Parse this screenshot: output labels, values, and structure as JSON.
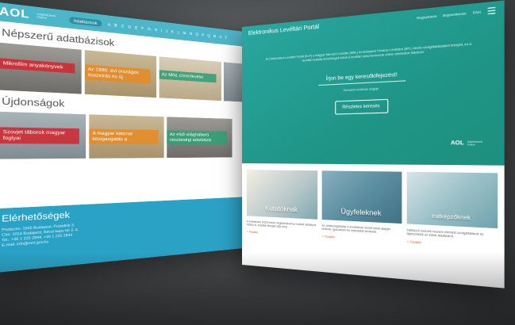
{
  "left_site": {
    "logo": "AOL",
    "logo_sub": "Adatbázisok Online",
    "search_label": "Adatbázisok",
    "alphabet": "A B C D E F G H I J K L M N O P Q R S T",
    "popular_heading": "Népszerű adatbázisok",
    "popular": [
      {
        "label": "Mikrofilm anyakönyvek"
      },
      {
        "label": "Az 1590. évi országos összeírás és új"
      },
      {
        "label": "Az MNL címerlevelei"
      }
    ],
    "new_heading": "Újdonságok",
    "news": [
      {
        "label": "Szovjet táborok magyar foglyai"
      },
      {
        "label": "A magyar katonai közigazgatás a"
      },
      {
        "label": "Az első világháború veszteségi adatbázis"
      }
    ],
    "contact_heading": "Elérhetőségek",
    "contact_lines": [
      "Postacím: 1550 Budapest, Postafiók 3.",
      "Cím: 1014 Budapest, Bécsi kapu tér 2–4.",
      "Tel.: +36 1 225 2844, +36 1 225 2844",
      "E-mail: info@mnl.gov.hu"
    ]
  },
  "right_site": {
    "title": "Elektronikus Levéltári Portál",
    "nav": [
      "Regisztráció",
      "Bejelentkezés",
      "ENG"
    ],
    "intro": "Az Elektronikus Levéltári Portál (ELP) a Magyar Nemzeti Levéltár (MNL) és Budapest Főváros Levéltára (BFL) közös szolgáltatásaként létrejött, és a levéltári kutatás lehetőségeit bővíti a levéltári dokumentumok online elérhetővé tételével.",
    "search_label": "Írjon be egy keresőkifejezést!",
    "search_hint": "Keresési szintaxis súgója",
    "search_button": "Részletes keresés",
    "aol_logo": "AOL",
    "aol_sub": "Adatbázisok Online",
    "cards": [
      {
        "title": "Kutatóknak",
        "text": "A levéltárban őrzött iratok megtekintéséhez kutatói adatlapot töltsön ki, kutatási témáját adja meg.",
        "more": "+ Tovább"
      },
      {
        "title": "Ügyfeleknek",
        "text": "Az adatszolgáltatás a levéltárban őrzött iratok alapján történik; igazolások és másolatok kérhetők.",
        "more": "+ Tovább"
      },
      {
        "title": "Iratképzőknek",
        "text": "Iratképző szervek részére elérhető szolgáltatások és tájékoztatók az iratok átadásáról.",
        "more": "+ Tovább"
      }
    ]
  }
}
